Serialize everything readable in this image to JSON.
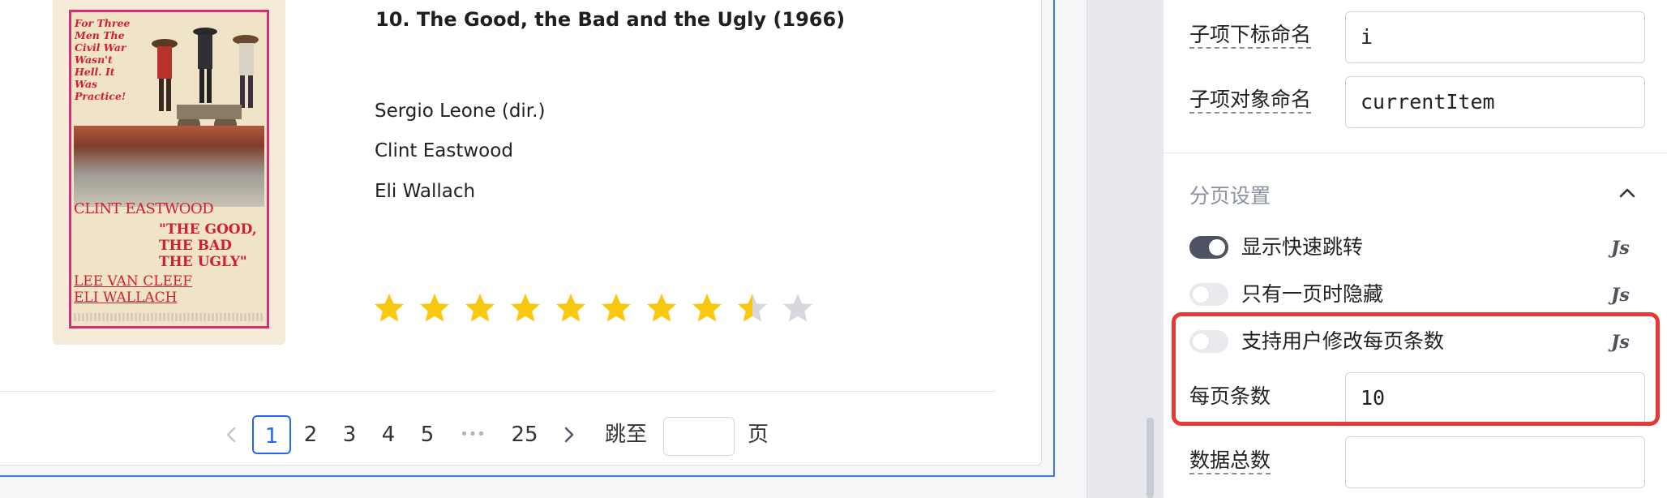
{
  "movie": {
    "title": "10. The Good, the Bad and the Ugly (1966)",
    "credits": [
      "Sergio Leone (dir.)",
      "Clint Eastwood",
      "Eli Wallach"
    ],
    "rating": 8.5,
    "rating_max": 10,
    "star_color": "#f9c80e",
    "star_empty_color": "#d6d8de",
    "poster": {
      "tagline": "For Three Men The Civil War Wasn't Hell. It Was Practice!",
      "top_name": "CLINT EASTWOOD",
      "title_lines": [
        "\"THE GOOD,",
        "THE BAD",
        "THE UGLY\""
      ],
      "bottom_names": [
        "LEE VAN CLEEF",
        "ELI WALLACH"
      ]
    }
  },
  "pagination": {
    "prev_icon": "chevron-left-icon",
    "pages": [
      "1",
      "2",
      "3",
      "4",
      "5"
    ],
    "active_page": "1",
    "ellipsis": "•••",
    "last_page": "25",
    "next_icon": "chevron-right-icon",
    "jump_label": "跳至",
    "jump_value": "",
    "page_suffix": "页",
    "accent": "#2468f2"
  },
  "panel": {
    "index_name_label": "子项下标命名",
    "index_name_value": "i",
    "item_name_label": "子项对象命名",
    "item_name_value": "currentItem",
    "section_title": "分页设置",
    "section_icon": "chevron-up-icon",
    "toggles": [
      {
        "label": "显示快速跳转",
        "on": true,
        "js": "Js"
      },
      {
        "label": "只有一页时隐藏",
        "on": false,
        "js": "Js"
      },
      {
        "label": "支持用户修改每页条数",
        "on": false,
        "js": "Js"
      }
    ],
    "page_size_label": "每页条数",
    "page_size_value": "10",
    "total_label": "数据总数",
    "total_value": "",
    "highlight_color": "#e53935"
  }
}
